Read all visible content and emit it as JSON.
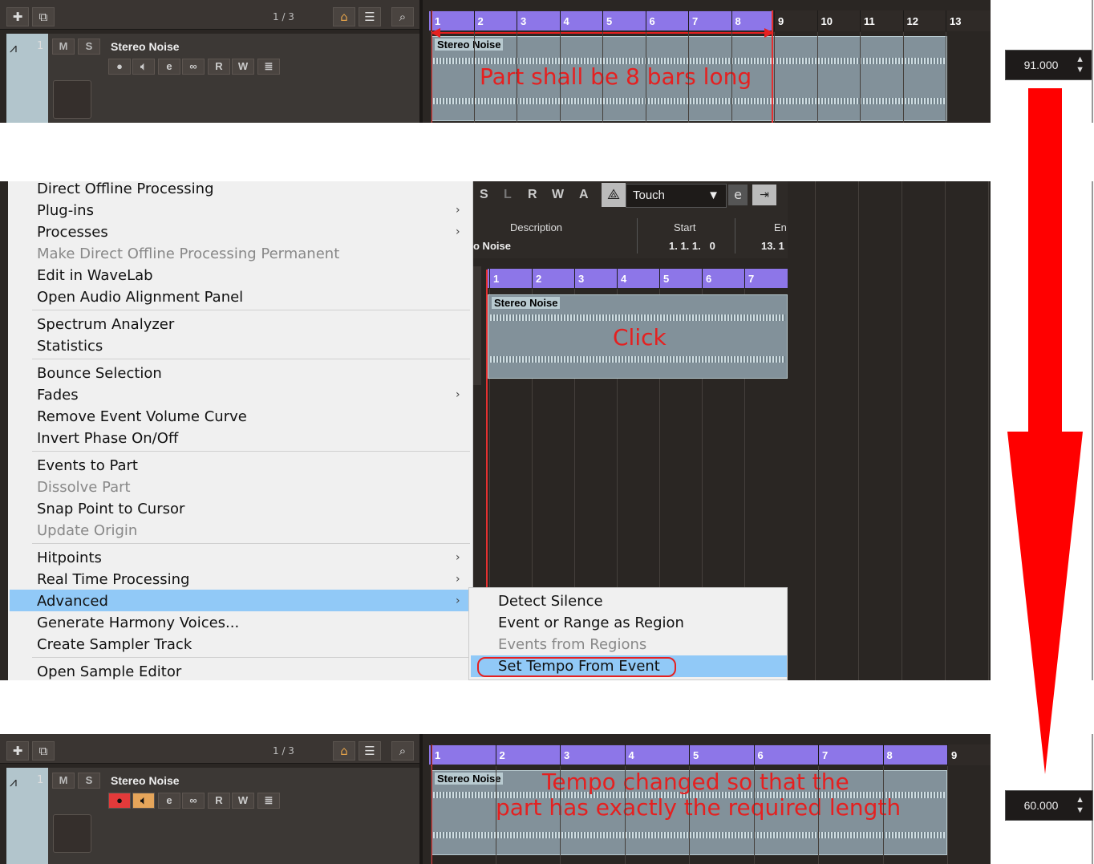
{
  "top": {
    "toolbar": {
      "add_icon": "plus-icon",
      "folder_icon": "folder-icon",
      "counter": "1 / 3",
      "search_icon": "search-icon"
    },
    "track": {
      "number": "1",
      "mute": "M",
      "solo": "S",
      "name": "Stereo Noise",
      "read": "R",
      "write": "W"
    },
    "ruler_ticks": [
      "1",
      "2",
      "3",
      "4",
      "5",
      "6",
      "7",
      "8",
      "9",
      "10",
      "11",
      "12",
      "13"
    ],
    "event_label": "Stereo Noise",
    "annotation": "Part shall be 8 bars long",
    "tempo": "91.000"
  },
  "menu": {
    "items": [
      {
        "label": "Direct Offline Processing",
        "disabled": false,
        "submenu": false
      },
      {
        "label": "Plug-ins",
        "disabled": false,
        "submenu": true
      },
      {
        "label": "Processes",
        "disabled": false,
        "submenu": true
      },
      {
        "label": "Make Direct Offline Processing Permanent",
        "disabled": true,
        "submenu": false
      },
      {
        "label": "Edit in WaveLab",
        "disabled": false,
        "submenu": false
      },
      {
        "label": "Open Audio Alignment Panel",
        "disabled": false,
        "submenu": false
      },
      {
        "label": "Spectrum Analyzer",
        "disabled": false,
        "submenu": false
      },
      {
        "label": "Statistics",
        "disabled": false,
        "submenu": false
      },
      {
        "label": "Bounce Selection",
        "disabled": false,
        "submenu": false
      },
      {
        "label": "Fades",
        "disabled": false,
        "submenu": true
      },
      {
        "label": "Remove Event Volume Curve",
        "disabled": false,
        "submenu": false
      },
      {
        "label": "Invert Phase On/Off",
        "disabled": false,
        "submenu": false
      },
      {
        "label": "Events to Part",
        "disabled": false,
        "submenu": false
      },
      {
        "label": "Dissolve Part",
        "disabled": true,
        "submenu": false
      },
      {
        "label": "Snap Point to Cursor",
        "disabled": false,
        "submenu": false
      },
      {
        "label": "Update Origin",
        "disabled": true,
        "submenu": false
      },
      {
        "label": "Hitpoints",
        "disabled": false,
        "submenu": true
      },
      {
        "label": "Real Time Processing",
        "disabled": false,
        "submenu": true
      },
      {
        "label": "Advanced",
        "disabled": false,
        "submenu": true,
        "highlighted": true
      },
      {
        "label": "Generate Harmony Voices...",
        "disabled": false,
        "submenu": false
      },
      {
        "label": "Create Sampler Track",
        "disabled": false,
        "submenu": false
      },
      {
        "label": "Open Sample Editor",
        "disabled": false,
        "submenu": false
      }
    ],
    "submenu": [
      {
        "label": "Detect Silence",
        "disabled": false
      },
      {
        "label": "Event or Range as Region",
        "disabled": false
      },
      {
        "label": "Events from Regions",
        "disabled": true
      },
      {
        "label": "Set Tempo From Event",
        "disabled": false,
        "highlighted": true
      }
    ]
  },
  "editor": {
    "buttons": [
      "S",
      "L",
      "R",
      "W",
      "A"
    ],
    "automation_mode": "Touch",
    "col_description": "Description",
    "col_start": "Start",
    "col_end": "En",
    "row_description": "o Noise",
    "row_start": "1. 1. 1.   0",
    "row_end": "13. 1",
    "ruler_ticks": [
      "1",
      "2",
      "3",
      "4",
      "5",
      "6",
      "7"
    ],
    "event_label": "Stereo Noise",
    "annotation": "Click"
  },
  "bottom": {
    "toolbar": {
      "counter": "1 / 3"
    },
    "track": {
      "number": "1",
      "mute": "M",
      "solo": "S",
      "name": "Stereo Noise",
      "read": "R",
      "write": "W"
    },
    "ruler_ticks": [
      "1",
      "2",
      "3",
      "4",
      "5",
      "6",
      "7",
      "8",
      "9"
    ],
    "event_label": "Stereo Noise",
    "annotation_line1": "Tempo changed so that the",
    "annotation_line2": "part has exactly the required length",
    "tempo": "60.000"
  },
  "colors": {
    "cycle": "#8d76e8",
    "annotation": "#e52020",
    "highlight": "#91c9f7"
  }
}
